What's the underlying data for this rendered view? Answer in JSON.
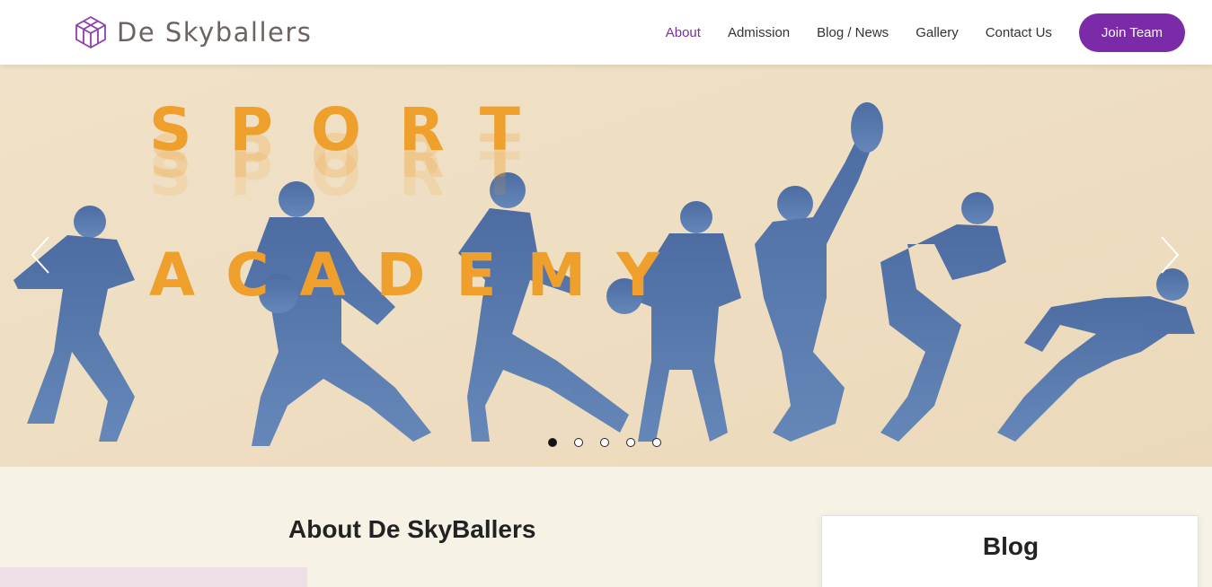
{
  "brand": {
    "name": "De Skyballers",
    "icon": "cube-logo-icon",
    "color": "#7b2aa8"
  },
  "nav": {
    "items": [
      {
        "label": "About",
        "active": true
      },
      {
        "label": "Admission",
        "active": false
      },
      {
        "label": "Blog / News",
        "active": false
      },
      {
        "label": "Gallery",
        "active": false
      },
      {
        "label": "Contact Us",
        "active": false
      }
    ],
    "cta_label": "Join Team"
  },
  "hero": {
    "line1": "SPORT",
    "line2": "ACADEMY",
    "prev_icon": "chevron-left-icon",
    "next_icon": "chevron-right-icon",
    "slides": 5,
    "active_slide": 1,
    "accent_color": "#efa02c",
    "silhouette_color": "#4a6fa5"
  },
  "main": {
    "about_title": "About De SkyBallers"
  },
  "sidebar": {
    "blog_title": "Blog"
  }
}
